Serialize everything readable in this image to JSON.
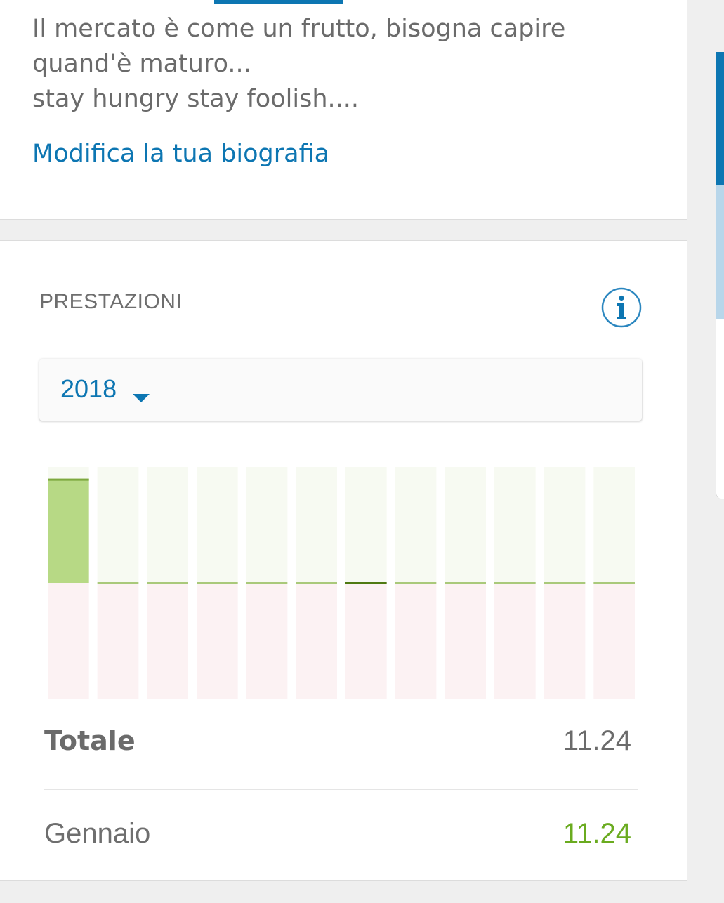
{
  "bio": {
    "text": "Il mercato è come un frutto, bisogna capire\nquand'è maturo...\nstay hungry stay foolish....",
    "edit_link": "Modifica la tua biografia"
  },
  "performance": {
    "title": "PRESTAZIONI",
    "info_icon": "info-icon",
    "year_selected": "2018",
    "dropdown_icon": "caret-down-icon",
    "totale_label": "Totale",
    "totale_value": "11.24",
    "months": [
      {
        "label": "Gennaio",
        "value": "11.24"
      }
    ]
  },
  "chart_data": {
    "type": "bar",
    "categories": [
      "",
      "",
      "",
      "",
      "",
      "",
      "",
      "",
      "",
      "",
      "",
      ""
    ],
    "values": [
      11.24,
      0,
      0,
      0,
      0,
      0,
      0,
      0,
      0,
      0,
      0,
      0
    ],
    "ylim": [
      -12,
      12
    ],
    "colors": {
      "positive_bar": "#b7d985",
      "positive_bar_top": "#7ea83f",
      "positive_bg": "#f7faf2",
      "negative_bg": "#fcf2f3",
      "zero_line": "#a9c97a",
      "zero_line_dark": "#4f7a12"
    }
  }
}
